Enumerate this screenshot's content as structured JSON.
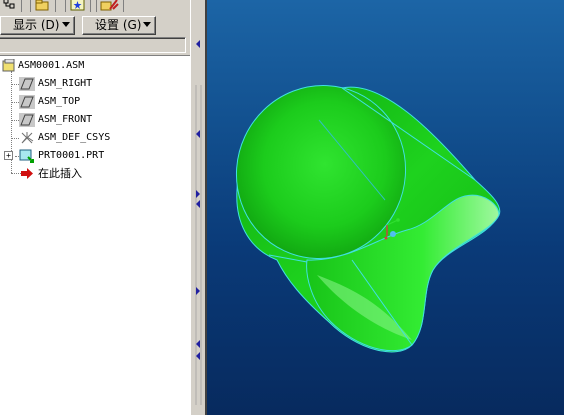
{
  "toolbar": {
    "show_menu": "显示 (D)",
    "settings_menu": "设置 (G)"
  },
  "tree": {
    "items": [
      {
        "label": "ASM0001.ASM",
        "icon": "assembly-icon"
      },
      {
        "label": "ASM_RIGHT",
        "icon": "datum-plane-icon"
      },
      {
        "label": "ASM_TOP",
        "icon": "datum-plane-icon"
      },
      {
        "label": "ASM_FRONT",
        "icon": "datum-plane-icon"
      },
      {
        "label": "ASM_DEF_CSYS",
        "icon": "csys-icon"
      },
      {
        "label": "PRT0001.PRT",
        "icon": "part-icon",
        "expand": "+"
      },
      {
        "label": "在此插入",
        "icon": "insert-here-arrow-icon"
      }
    ]
  },
  "viewport": {
    "model_color": "#1ee01e",
    "edge_color": "#40e0e0",
    "background_top": "#1c65a6",
    "background_bottom": "#072a5e"
  }
}
